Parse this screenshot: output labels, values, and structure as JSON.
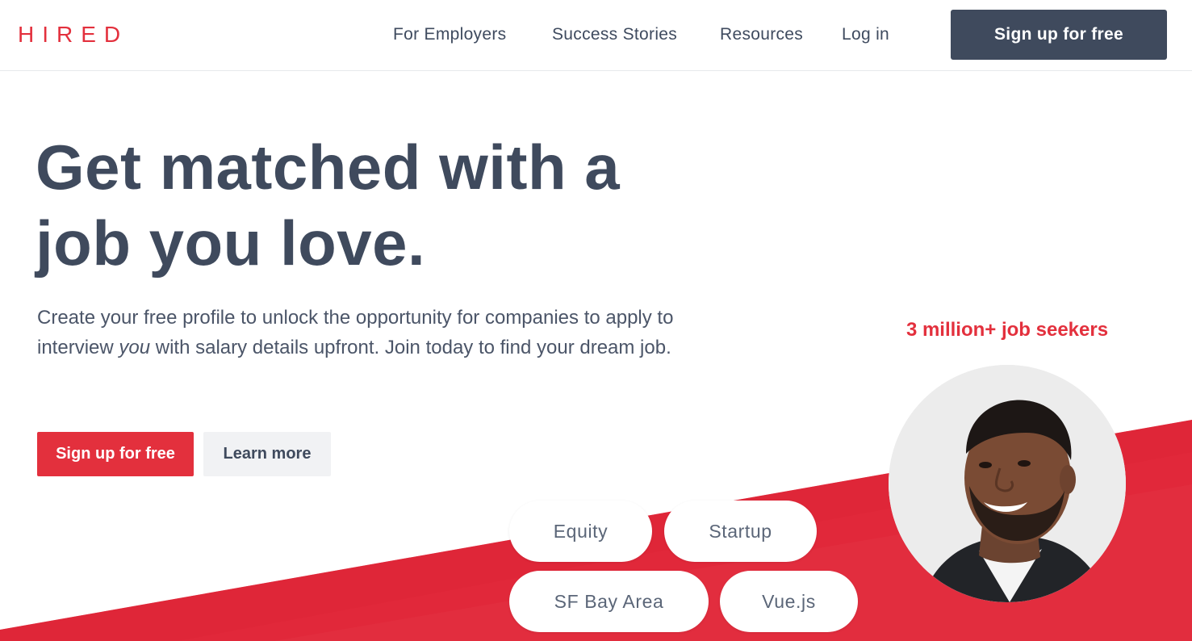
{
  "brand": {
    "logo_text": "HIRED",
    "accent_color": "#e3303d",
    "dark_color": "#3f4a5d"
  },
  "nav": {
    "items": [
      {
        "label": "For Employers"
      },
      {
        "label": "Success Stories"
      },
      {
        "label": "Resources"
      },
      {
        "label": "Log in"
      }
    ],
    "cta_label": "Sign up for free"
  },
  "hero": {
    "headline": "Get matched with a job you love.",
    "subcopy_before": "Create your free profile to unlock the opportunity for companies to apply to interview ",
    "subcopy_emphasis": "you",
    "subcopy_after": " with salary details upfront. Join today to find your dream job.",
    "primary_button": "Sign up for free",
    "secondary_button": "Learn more"
  },
  "showcase": {
    "stat": "3 million+ job seekers",
    "avatar_icon": "person-photo",
    "tags": [
      {
        "label": "Equity"
      },
      {
        "label": "Startup"
      },
      {
        "label": "SF Bay Area"
      },
      {
        "label": "Vue.js"
      }
    ]
  }
}
